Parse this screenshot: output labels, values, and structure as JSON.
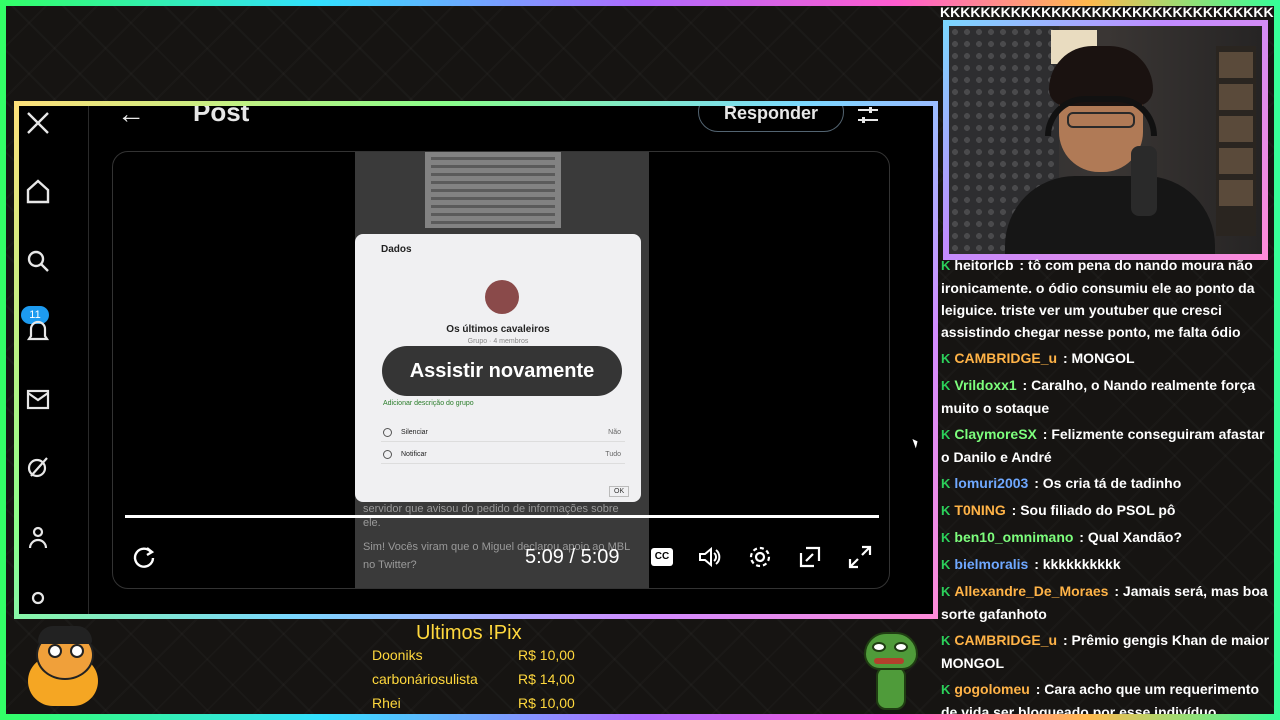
{
  "overlay": {
    "cam_title": "KKKKKKKKKKKKKKKKKKKKKKKKKKKKKKKKKK"
  },
  "x_app": {
    "notif_count": "11",
    "post_title": "Post",
    "reply_label": "Responder",
    "panel": {
      "title": "Dados",
      "group_name": "Os últimos cavaleiros",
      "group_sub": "Grupo · 4 membros",
      "group_desc": "Adicionar descrição do grupo",
      "rows": [
        {
          "label": "Silenciar",
          "value": "Não"
        },
        {
          "label": "Notificar",
          "value": "Tudo"
        }
      ],
      "ok": "OK"
    },
    "chat_below_1": "servidor que avisou do pedido de informações sobre ele.",
    "chat_below_2": "Sim! Vocês viram que o Miguel declarou apoio ao MBL no Twitter?",
    "replay_label": "Assistir novamente",
    "time": "5:09 / 5:09",
    "cc": "CC",
    "progress": 1.0
  },
  "chat": [
    {
      "user": "heitorlcb",
      "color": "#ffffff",
      "text": "tô com pena do nando moura não ironicamente. o ódio consumiu ele ao ponto da leiguice. triste ver um youtuber que cresci assistindo chegar nesse ponto, me falta ódio"
    },
    {
      "user": "CAMBRIDGE_u",
      "color": "#ffb347",
      "text": "MONGOL"
    },
    {
      "user": "Vrildoxx1",
      "color": "#7dff7d",
      "text": "Caralho, o Nando realmente força muito o sotaque"
    },
    {
      "user": "ClaymoreSX",
      "color": "#7dff7d",
      "text": "Felizmente conseguiram afastar o Danilo e André"
    },
    {
      "user": "lomuri2003",
      "color": "#6fa8ff",
      "text": "Os cria tá de tadinho"
    },
    {
      "user": "T0NING",
      "color": "#ffb347",
      "text": "Sou filiado do PSOL pô"
    },
    {
      "user": "ben10_omnimano",
      "color": "#7dff7d",
      "text": "Qual Xandão?"
    },
    {
      "user": "bielmoralis",
      "color": "#6fa8ff",
      "text": "kkkkkkkkkk"
    },
    {
      "user": "Allexandre_De_Moraes",
      "color": "#ffb347",
      "text": "Jamais será, mas boa sorte gafanhoto"
    },
    {
      "user": "CAMBRIDGE_u",
      "color": "#ffb347",
      "text": "Prêmio gengis Khan de maior MONGOL"
    },
    {
      "user": "gogolomeu",
      "color": "#ffb347",
      "text": "Cara acho que um requerimento de vida ser bloqueado por esse indivíduo"
    }
  ],
  "pix": {
    "title": "Ultimos !Pix",
    "rows": [
      {
        "name": "Dooniks",
        "value": "R$ 10,00"
      },
      {
        "name": "carbonáriosulista",
        "value": "R$ 14,00"
      },
      {
        "name": "Rhei",
        "value": "R$ 10,00"
      }
    ]
  }
}
